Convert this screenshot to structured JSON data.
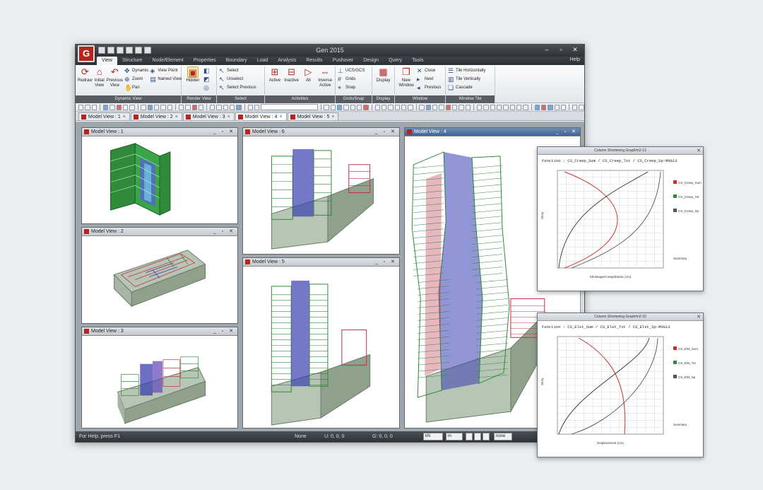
{
  "app": {
    "title": "Gen 2015",
    "help": "Help",
    "status_help": "For Help, press F1",
    "status_none": "None",
    "status_u": "U: 0, 0, 0",
    "status_g": "G: 0, 0, 0",
    "unit_force": "kN",
    "unit_length": "m",
    "status_none2": "none"
  },
  "menu": [
    "View",
    "Structure",
    "Node/Element",
    "Properties",
    "Boundary",
    "Load",
    "Analysis",
    "Results",
    "Pushover",
    "Design",
    "Query",
    "Tools"
  ],
  "ribbon": {
    "groups": [
      {
        "label": "Dynamic View",
        "buttons": [
          "Redraw",
          "Initial View",
          "Previous View"
        ],
        "small": [
          "Dynamic",
          "Zoom",
          "Pan",
          "View Point",
          "Named View"
        ]
      },
      {
        "label": "Render View",
        "buttons": [
          "Hidden"
        ]
      },
      {
        "label": "Select",
        "small": [
          "Select",
          "Unselect",
          "Select Previous"
        ]
      },
      {
        "label": "Activities",
        "buttons": [
          "Active",
          "Inactive",
          "All",
          "Inverse Active"
        ]
      },
      {
        "label": "Grids/Snap",
        "small": [
          "UCS/GCS",
          "Grids",
          "Snap"
        ]
      },
      {
        "label": "Display",
        "buttons": [
          "Display"
        ]
      },
      {
        "label": "Window",
        "buttons": [
          "New Window"
        ],
        "small": [
          "Close",
          "Next",
          "Previous"
        ]
      },
      {
        "label": "Window Tile",
        "small": [
          "Tile Horizontally",
          "Tile Vertically",
          "Cascade"
        ]
      }
    ]
  },
  "doc_tabs": [
    "Model View : 1",
    "Model View : 2",
    "Model View : 3",
    "Model View : 4",
    "Model View : 5"
  ],
  "views": {
    "v1": "Model View : 1",
    "v2": "Model View : 2",
    "v3": "Model View : 3",
    "v4": "Model View : 4",
    "v5": "Model View : 5",
    "v6": "Model View : 6"
  },
  "graphs": [
    {
      "window_title": "Column Shortening Graph/m2-13",
      "function": "Function : CS_Creep_Sum / CS_Creep_Tot / CS_Creep_Sp-M0G13",
      "legend": [
        "CS_Creep_Sum",
        "CS_Creep_Tot",
        "CS_Creep_Sp"
      ],
      "legend_label": "Summary",
      "xlabel": "Shrinkage/Creep/Elastic (cm)",
      "ylabel": "Story"
    },
    {
      "window_title": "Column Shortening Graph/m2-32",
      "function": "Function : CS_Elst_Sum / CS_Elst_Tot / CS_Elst_Sp-M0G13",
      "legend": [
        "CS_Elst_Sum",
        "CS_Elst_Tot",
        "CS_Elst_Sp"
      ],
      "legend_label": "Summary",
      "xlabel": "Displacement (cm)",
      "ylabel": "Story"
    }
  ],
  "colors": {
    "accent": "#b3261e",
    "frame_green": "#2f8a3a",
    "frame_blue": "#3b3fb0",
    "frame_red": "#c0304a",
    "curve_red": "#d12c2c",
    "curve_dark": "#333333"
  }
}
